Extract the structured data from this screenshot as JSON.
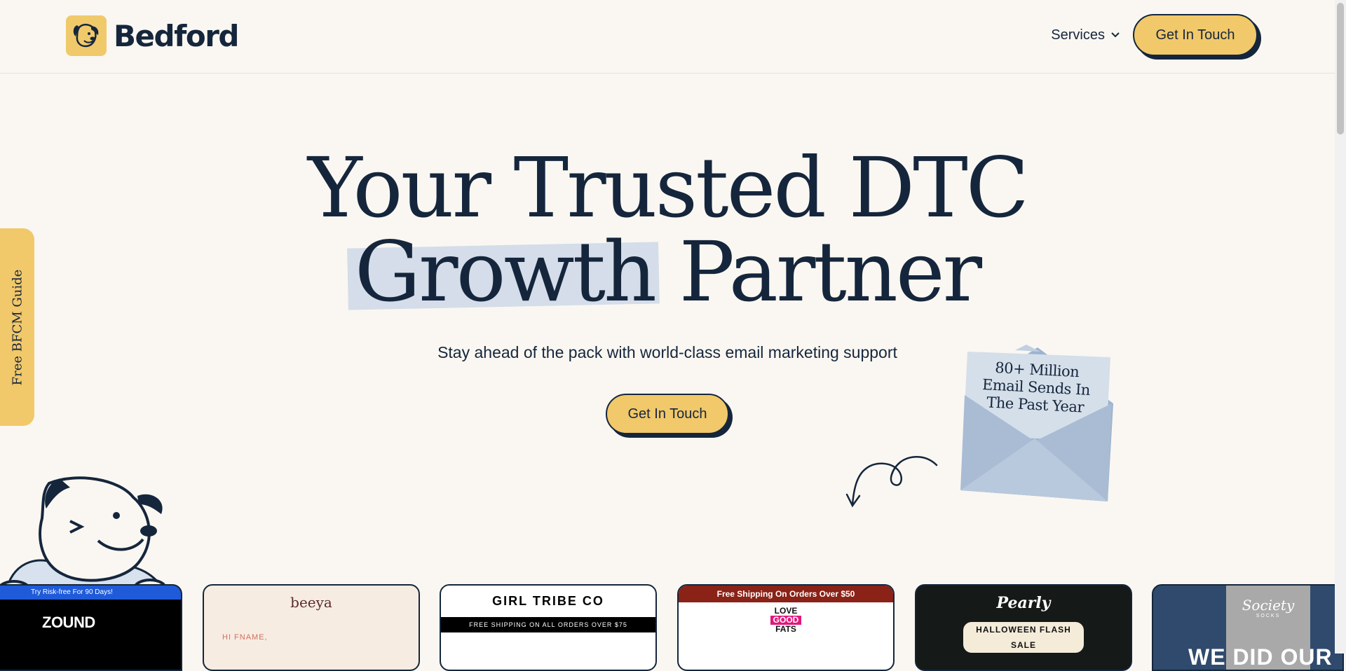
{
  "header": {
    "brand": "Bedford",
    "nav": {
      "services_label": "Services",
      "cta_label": "Get In Touch"
    }
  },
  "hero": {
    "title_line1": "Your Trusted DTC",
    "title_highlight": "Growth",
    "title_rest": "Partner",
    "subtitle": "Stay ahead of the pack with world-class email marketing support",
    "cta_label": "Get In Touch"
  },
  "envelope": {
    "line1": "80+ Million",
    "line2": "Email Sends In",
    "line3": "The Past Year"
  },
  "side_tab": {
    "label": "Free BFCM Guide"
  },
  "cards": [
    {
      "banner": "Try Risk-free For 90 Days!",
      "brand": "ZOUND"
    },
    {
      "brand": "beeya",
      "greeting": "HI FNAME,"
    },
    {
      "brand": "GIRL TRIBE CO",
      "banner": "FREE SHIPPING ON ALL ORDERS OVER $75"
    },
    {
      "banner": "Free Shipping On Orders Over $50",
      "logo_top": "LOVE",
      "logo_mid": "GOOD",
      "logo_bottom": "FATS"
    },
    {
      "brand": "Pearly",
      "sale": "HALLOWEEN FLASH SALE"
    },
    {
      "brand": "Society",
      "brand_sub": "SOCKS",
      "headline": "WE DID OUR"
    }
  ],
  "colors": {
    "background": "#faf7f2",
    "navy": "#15263c",
    "yellow": "#f1c86a",
    "highlight": "#d4dde9",
    "envelope": "#a9bcd4"
  }
}
